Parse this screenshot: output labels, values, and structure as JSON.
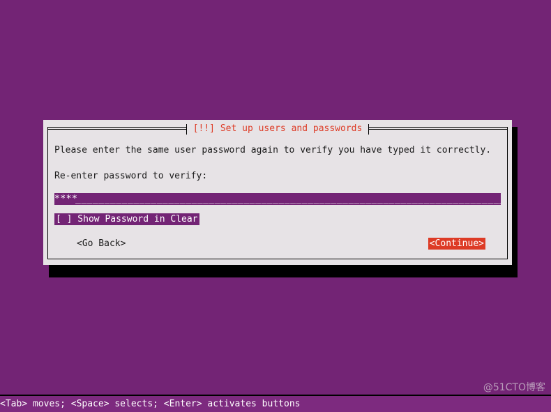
{
  "screen": {
    "background_color": "#732475",
    "accent_red": "#dd3b26",
    "highlight_purple": "#732475",
    "panel_color": "#e7e3e6"
  },
  "dialog": {
    "title": "[!!] Set up users and passwords",
    "prompt": "Please enter the same user password again to verify you have typed it correctly.",
    "field_label": "Re-enter password to verify:",
    "password": {
      "masked_value": "****",
      "fill_char": "_",
      "placeholder": ""
    },
    "checkbox": {
      "marker": "[ ]",
      "label": "Show Password in Clear",
      "checked": false,
      "full_text": "[ ] Show Password in Clear"
    },
    "buttons": {
      "back_label": "<Go Back>",
      "continue_label": "<Continue>"
    }
  },
  "status_bar": {
    "text": "<Tab> moves; <Space> selects; <Enter> activates buttons"
  },
  "watermark": {
    "text": "@51CTO博客"
  }
}
